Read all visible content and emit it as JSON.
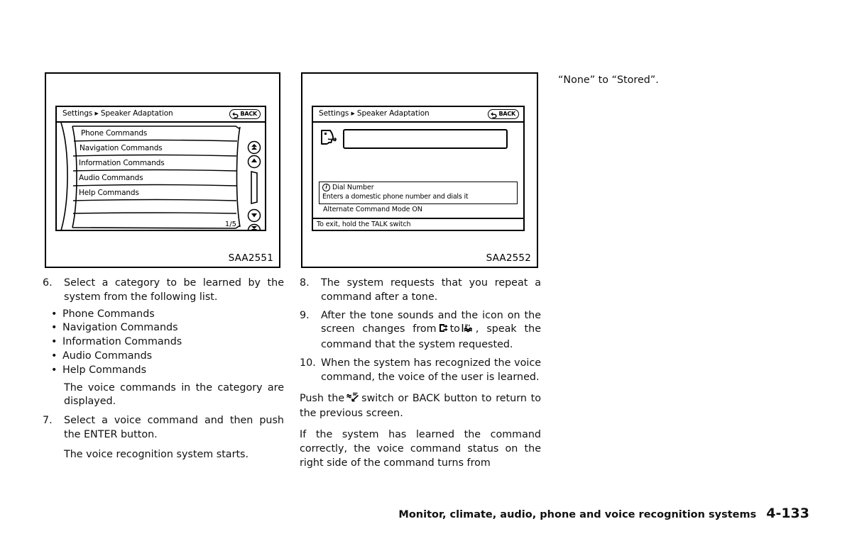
{
  "page": {
    "footer_title": "Monitor, climate, audio, phone and voice recognition systems",
    "footer_page": "4-133"
  },
  "figures": [
    {
      "code": "SAA2551",
      "screen": {
        "header_title": "Settings ▸ Speaker Adaptation",
        "back_label": "BACK",
        "back_icon": "back-arrow-icon",
        "list_items": [
          "Phone Commands",
          "Navigation Commands",
          "Information Commands",
          "Audio Commands",
          "Help Commands"
        ],
        "page_indicator": "1/5",
        "scroll_controls": [
          "scroll-top-icon",
          "scroll-up-icon",
          "scrollbar-thumb",
          "scroll-down-icon",
          "scroll-bottom-icon"
        ]
      }
    },
    {
      "code": "SAA2552",
      "screen": {
        "header_title": "Settings ▸ Speaker Adaptation",
        "back_label": "BACK",
        "back_icon": "back-arrow-icon",
        "speaker_icon": "speaking-face-icon",
        "input_value": "",
        "command_title": "Dial Number",
        "command_desc": "Enters a domestic phone number and dials it",
        "alternate_mode": "Alternate Command Mode ON",
        "status_text": "To exit, hold the TALK switch"
      }
    }
  ],
  "left_column": {
    "step6": {
      "num": "6.",
      "text": "Select a category to be learned by the system from the following list.",
      "bullets": [
        "Phone Commands",
        "Navigation Commands",
        "Information Commands",
        "Audio Commands",
        "Help Commands"
      ],
      "note": "The voice commands in the category are displayed."
    },
    "step7": {
      "num": "7.",
      "text": "Select a voice command and then push the ENTER button.",
      "note": "The voice recognition system starts."
    }
  },
  "mid_column": {
    "step8": {
      "num": "8.",
      "text": "The system requests that you repeat a command after a tone."
    },
    "step9": {
      "num": "9.",
      "text_a": "After the tone sounds and the icon on the screen changes from",
      "text_b": "to",
      "text_c": ", speak the command that the system requested.",
      "icon_a": "command-box-icon",
      "icon_b": "speak-now-icon"
    },
    "step10": {
      "num": "10.",
      "text": "When the system has recognized the voice command, the voice of the user is learned."
    },
    "para_push_a": "Push the",
    "para_push_icon": "talk-switch-icon",
    "para_push_b": "switch or BACK button to return to the previous screen.",
    "para_learned": "If the system has learned the command correctly, the voice command status on the right side of the command turns from"
  },
  "right_column": {
    "continuation": "“None” to “Stored”."
  }
}
